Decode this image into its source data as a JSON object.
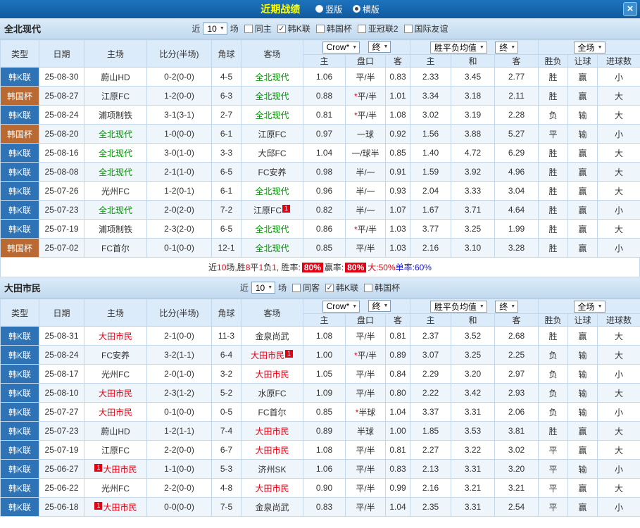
{
  "topbar": {
    "title": "近期战绩",
    "vertical_label": "竖版",
    "horizontal_label": "横版",
    "selected_view": "横版"
  },
  "icons": {
    "dropdown_arrow": "▼",
    "close": "×",
    "check": "✓"
  },
  "colors": {
    "topbar_blue": "#1a6db5",
    "band_blue": "#cfe3f3",
    "league_k_blue": "#2e73b5",
    "league_cup_orange": "#b96a33",
    "score_red": "#e60012",
    "focus_green": "#009900",
    "focus_red": "#e60012",
    "result_red": "#e60012",
    "result_blue": "#1414cc",
    "result_green": "#009933"
  },
  "header": {
    "type": "类型",
    "date": "日期",
    "home": "主场",
    "score": "比分(半场)",
    "corner": "角球",
    "away": "客场",
    "bookmaker": "Crow*",
    "terminal": "终",
    "avg": "胜平负均值",
    "scope": "全场",
    "sub": [
      "主",
      "盘口",
      "客",
      "主",
      "和",
      "客",
      "胜负",
      "让球",
      "进球数"
    ]
  },
  "sections": [
    {
      "team": "全北现代",
      "focus_color": "#009900",
      "filter": {
        "near": "近",
        "count": "10",
        "games": "场",
        "checkboxes": [
          {
            "label": "同主",
            "checked": false
          },
          {
            "label": "韩K联",
            "checked": true
          },
          {
            "label": "韩国杯",
            "checked": false
          },
          {
            "label": "亚冠联2",
            "checked": false
          },
          {
            "label": "国际友谊",
            "checked": false
          }
        ]
      },
      "rows": [
        {
          "lg": "韩K联",
          "lgc": "k",
          "d": "25-08-30",
          "h": "蔚山HD",
          "hf": false,
          "hb": null,
          "s": "0-2(0-0)",
          "cn": "4-5",
          "a": "全北现代",
          "af": true,
          "ab": null,
          "o": [
            "1.06",
            "平/半",
            "0.83"
          ],
          "v": [
            "2.33",
            "3.45",
            "2.77"
          ],
          "res": [
            [
              "胜",
              "red"
            ],
            [
              "赢",
              "red"
            ],
            [
              "小",
              "red"
            ]
          ]
        },
        {
          "lg": "韩国杯",
          "lgc": "cup",
          "d": "25-08-27",
          "h": "江原FC",
          "hf": false,
          "hb": null,
          "s": "1-2(0-0)",
          "cn": "6-3",
          "a": "全北现代",
          "af": true,
          "ab": null,
          "o": [
            "0.88",
            "*平/半",
            "1.01"
          ],
          "v": [
            "3.34",
            "3.18",
            "2.11"
          ],
          "res": [
            [
              "胜",
              "red"
            ],
            [
              "赢",
              "red"
            ],
            [
              "大",
              "red"
            ]
          ]
        },
        {
          "lg": "韩K联",
          "lgc": "k",
          "d": "25-08-24",
          "h": "浦项制铁",
          "hf": false,
          "hb": null,
          "s": "3-1(3-1)",
          "cn": "2-7",
          "a": "全北现代",
          "af": true,
          "ab": null,
          "o": [
            "0.81",
            "*平/半",
            "1.08"
          ],
          "v": [
            "3.02",
            "3.19",
            "2.28"
          ],
          "res": [
            [
              "负",
              "blue"
            ],
            [
              "输",
              "green"
            ],
            [
              "大",
              "red"
            ]
          ]
        },
        {
          "lg": "韩国杯",
          "lgc": "cup",
          "d": "25-08-20",
          "h": "全北现代",
          "hf": true,
          "hb": null,
          "s": "1-0(0-0)",
          "cn": "6-1",
          "a": "江原FC",
          "af": false,
          "ab": null,
          "o": [
            "0.97",
            "一球",
            "0.92"
          ],
          "v": [
            "1.56",
            "3.88",
            "5.27"
          ],
          "res": [
            [
              "平",
              "blue"
            ],
            [
              "输",
              "green"
            ],
            [
              "小",
              "red"
            ]
          ]
        },
        {
          "lg": "韩K联",
          "lgc": "k",
          "d": "25-08-16",
          "h": "全北现代",
          "hf": true,
          "hb": null,
          "s": "3-0(1-0)",
          "cn": "3-3",
          "a": "大邱FC",
          "af": false,
          "ab": null,
          "o": [
            "1.04",
            "一/球半",
            "0.85"
          ],
          "v": [
            "1.40",
            "4.72",
            "6.29"
          ],
          "res": [
            [
              "胜",
              "red"
            ],
            [
              "赢",
              "red"
            ],
            [
              "大",
              "red"
            ]
          ]
        },
        {
          "lg": "韩K联",
          "lgc": "k",
          "d": "25-08-08",
          "h": "全北现代",
          "hf": true,
          "hb": null,
          "s": "2-1(1-0)",
          "cn": "6-5",
          "a": "FC安养",
          "af": false,
          "ab": null,
          "o": [
            "0.98",
            "半/一",
            "0.91"
          ],
          "v": [
            "1.59",
            "3.92",
            "4.96"
          ],
          "res": [
            [
              "胜",
              "red"
            ],
            [
              "赢",
              "red"
            ],
            [
              "大",
              "red"
            ]
          ]
        },
        {
          "lg": "韩K联",
          "lgc": "k",
          "d": "25-07-26",
          "h": "光州FC",
          "hf": false,
          "hb": null,
          "s": "1-2(0-1)",
          "cn": "6-1",
          "a": "全北现代",
          "af": true,
          "ab": null,
          "o": [
            "0.96",
            "半/一",
            "0.93"
          ],
          "v": [
            "2.04",
            "3.33",
            "3.04"
          ],
          "res": [
            [
              "胜",
              "red"
            ],
            [
              "赢",
              "red"
            ],
            [
              "大",
              "red"
            ]
          ]
        },
        {
          "lg": "韩K联",
          "lgc": "k",
          "d": "25-07-23",
          "h": "全北现代",
          "hf": true,
          "hb": null,
          "s": "2-0(2-0)",
          "cn": "7-2",
          "a": "江原FC",
          "af": false,
          "ab": [
            "after",
            "1"
          ],
          "o": [
            "0.82",
            "半/一",
            "1.07"
          ],
          "v": [
            "1.67",
            "3.71",
            "4.64"
          ],
          "res": [
            [
              "胜",
              "red"
            ],
            [
              "赢",
              "red"
            ],
            [
              "小",
              "red"
            ]
          ]
        },
        {
          "lg": "韩K联",
          "lgc": "k",
          "d": "25-07-19",
          "h": "浦项制铁",
          "hf": false,
          "hb": null,
          "s": "2-3(2-0)",
          "cn": "6-5",
          "a": "全北现代",
          "af": true,
          "ab": null,
          "o": [
            "0.86",
            "*平/半",
            "1.03"
          ],
          "v": [
            "3.77",
            "3.25",
            "1.99"
          ],
          "res": [
            [
              "胜",
              "red"
            ],
            [
              "赢",
              "red"
            ],
            [
              "大",
              "red"
            ]
          ]
        },
        {
          "lg": "韩国杯",
          "lgc": "cup",
          "d": "25-07-02",
          "h": "FC首尔",
          "hf": false,
          "hb": null,
          "s": "0-1(0-0)",
          "cn": "12-1",
          "a": "全北现代",
          "af": true,
          "ab": null,
          "o": [
            "0.85",
            "平/半",
            "1.03"
          ],
          "v": [
            "2.16",
            "3.10",
            "3.28"
          ],
          "res": [
            [
              "胜",
              "red"
            ],
            [
              "赢",
              "red"
            ],
            [
              "小",
              "red"
            ]
          ]
        }
      ],
      "summary": [
        [
          "近",
          "#333333"
        ],
        [
          "10",
          "#e60012"
        ],
        [
          "场,胜",
          "#333333"
        ],
        [
          "8",
          "#e60012"
        ],
        [
          "平",
          "#333333"
        ],
        [
          "1",
          "#e60012"
        ],
        [
          "负",
          "#333333"
        ],
        [
          "1",
          "#e60012"
        ],
        [
          ", 胜率: ",
          "#333333"
        ],
        [
          "80%",
          "badge"
        ],
        [
          " 赢率:",
          "#333333"
        ],
        [
          "80%",
          "badge"
        ],
        [
          " 大:50%",
          "#e60012"
        ],
        [
          " 单率:60%",
          "#1414cc"
        ]
      ]
    },
    {
      "team": "大田市民",
      "focus_color": "#e60012",
      "filter": {
        "near": "近",
        "count": "10",
        "games": "场",
        "checkboxes": [
          {
            "label": "同客",
            "checked": false
          },
          {
            "label": "韩K联",
            "checked": true
          },
          {
            "label": "韩国杯",
            "checked": false
          }
        ]
      },
      "rows": [
        {
          "lg": "韩K联",
          "lgc": "k",
          "d": "25-08-31",
          "h": "大田市民",
          "hf": true,
          "hb": null,
          "s": "2-1(0-0)",
          "cn": "11-3",
          "a": "金泉尚武",
          "af": false,
          "ab": null,
          "o": [
            "1.08",
            "平/半",
            "0.81"
          ],
          "v": [
            "2.37",
            "3.52",
            "2.68"
          ],
          "res": [
            [
              "胜",
              "red"
            ],
            [
              "赢",
              "red"
            ],
            [
              "大",
              "red"
            ]
          ]
        },
        {
          "lg": "韩K联",
          "lgc": "k",
          "d": "25-08-24",
          "h": "FC安养",
          "hf": false,
          "hb": null,
          "s": "3-2(1-1)",
          "cn": "6-4",
          "a": "大田市民",
          "af": true,
          "ab": [
            "after",
            "1"
          ],
          "o": [
            "1.00",
            "*平/半",
            "0.89"
          ],
          "v": [
            "3.07",
            "3.25",
            "2.25"
          ],
          "res": [
            [
              "负",
              "blue"
            ],
            [
              "输",
              "green"
            ],
            [
              "大",
              "red"
            ]
          ]
        },
        {
          "lg": "韩K联",
          "lgc": "k",
          "d": "25-08-17",
          "h": "光州FC",
          "hf": false,
          "hb": null,
          "s": "2-0(1-0)",
          "cn": "3-2",
          "a": "大田市民",
          "af": true,
          "ab": null,
          "o": [
            "1.05",
            "平/半",
            "0.84"
          ],
          "v": [
            "2.29",
            "3.20",
            "2.97"
          ],
          "res": [
            [
              "负",
              "blue"
            ],
            [
              "输",
              "green"
            ],
            [
              "小",
              "red"
            ]
          ]
        },
        {
          "lg": "韩K联",
          "lgc": "k",
          "d": "25-08-10",
          "h": "大田市民",
          "hf": true,
          "hb": null,
          "s": "2-3(1-2)",
          "cn": "5-2",
          "a": "水原FC",
          "af": false,
          "ab": null,
          "o": [
            "1.09",
            "平/半",
            "0.80"
          ],
          "v": [
            "2.22",
            "3.42",
            "2.93"
          ],
          "res": [
            [
              "负",
              "blue"
            ],
            [
              "输",
              "green"
            ],
            [
              "大",
              "red"
            ]
          ]
        },
        {
          "lg": "韩K联",
          "lgc": "k",
          "d": "25-07-27",
          "h": "大田市民",
          "hf": true,
          "hb": null,
          "s": "0-1(0-0)",
          "cn": "0-5",
          "a": "FC首尔",
          "af": false,
          "ab": null,
          "o": [
            "0.85",
            "*半球",
            "1.04"
          ],
          "v": [
            "3.37",
            "3.31",
            "2.06"
          ],
          "res": [
            [
              "负",
              "blue"
            ],
            [
              "输",
              "green"
            ],
            [
              "小",
              "red"
            ]
          ]
        },
        {
          "lg": "韩K联",
          "lgc": "k",
          "d": "25-07-23",
          "h": "蔚山HD",
          "hf": false,
          "hb": null,
          "s": "1-2(1-1)",
          "cn": "7-4",
          "a": "大田市民",
          "af": true,
          "ab": null,
          "o": [
            "0.89",
            "半球",
            "1.00"
          ],
          "v": [
            "1.85",
            "3.53",
            "3.81"
          ],
          "res": [
            [
              "胜",
              "red"
            ],
            [
              "赢",
              "red"
            ],
            [
              "大",
              "red"
            ]
          ]
        },
        {
          "lg": "韩K联",
          "lgc": "k",
          "d": "25-07-19",
          "h": "江原FC",
          "hf": false,
          "hb": null,
          "s": "2-2(0-0)",
          "cn": "6-7",
          "a": "大田市民",
          "af": true,
          "ab": null,
          "o": [
            "1.08",
            "平/半",
            "0.81"
          ],
          "v": [
            "2.27",
            "3.22",
            "3.02"
          ],
          "res": [
            [
              "平",
              "blue"
            ],
            [
              "赢",
              "red"
            ],
            [
              "大",
              "red"
            ]
          ]
        },
        {
          "lg": "韩K联",
          "lgc": "k",
          "d": "25-06-27",
          "h": "大田市民",
          "hf": true,
          "hb": [
            "before",
            "1"
          ],
          "s": "1-1(0-0)",
          "cn": "5-3",
          "a": "济州SK",
          "af": false,
          "ab": null,
          "o": [
            "1.06",
            "平/半",
            "0.83"
          ],
          "v": [
            "2.13",
            "3.31",
            "3.20"
          ],
          "res": [
            [
              "平",
              "blue"
            ],
            [
              "输",
              "green"
            ],
            [
              "小",
              "red"
            ]
          ]
        },
        {
          "lg": "韩K联",
          "lgc": "k",
          "d": "25-06-22",
          "h": "光州FC",
          "hf": false,
          "hb": null,
          "s": "2-2(0-0)",
          "cn": "4-8",
          "a": "大田市民",
          "af": true,
          "ab": null,
          "o": [
            "0.90",
            "平/半",
            "0.99"
          ],
          "v": [
            "2.16",
            "3.21",
            "3.21"
          ],
          "res": [
            [
              "平",
              "blue"
            ],
            [
              "赢",
              "red"
            ],
            [
              "大",
              "red"
            ]
          ]
        },
        {
          "lg": "韩K联",
          "lgc": "k",
          "d": "25-06-18",
          "h": "大田市民",
          "hf": true,
          "hb": [
            "before",
            "1"
          ],
          "s": "0-0(0-0)",
          "cn": "7-5",
          "a": "金泉尚武",
          "af": false,
          "ab": null,
          "o": [
            "0.83",
            "平/半",
            "1.04"
          ],
          "v": [
            "2.35",
            "3.31",
            "2.54"
          ],
          "res": [
            [
              "平",
              "blue"
            ],
            [
              "赢",
              "red"
            ],
            [
              "小",
              "red"
            ]
          ]
        }
      ],
      "summary": null
    }
  ]
}
